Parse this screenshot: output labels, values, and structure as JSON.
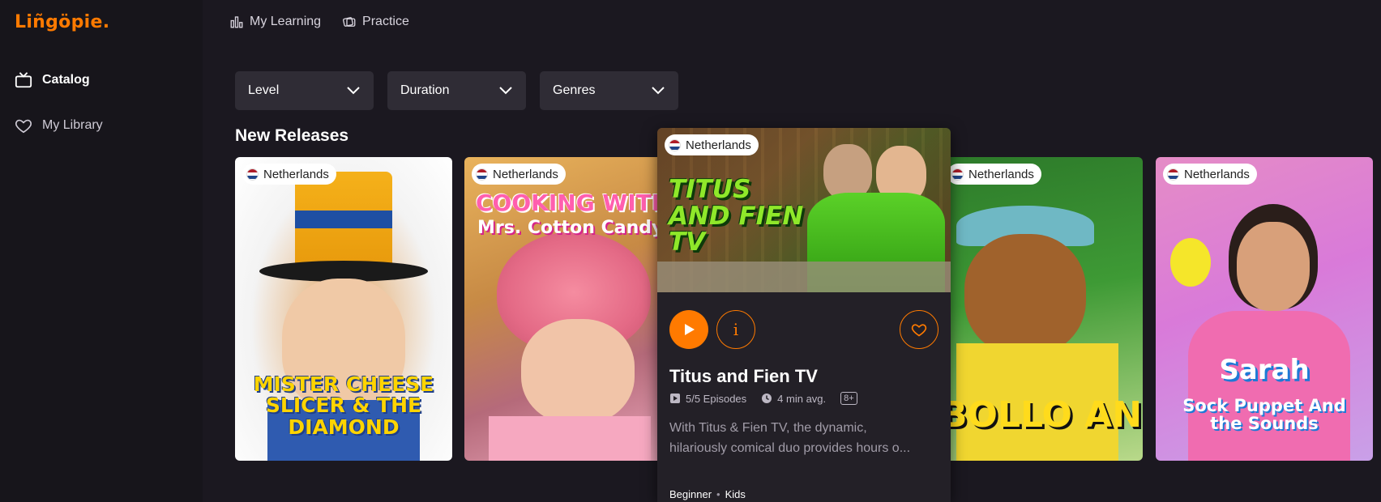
{
  "brand": {
    "logo": "Liñgöpie."
  },
  "sidebar": {
    "items": [
      {
        "label": "Catalog",
        "icon": "tv-icon",
        "active": true
      },
      {
        "label": "My Library",
        "icon": "heart-icon",
        "active": false
      }
    ]
  },
  "topnav": {
    "items": [
      {
        "label": "My Learning",
        "icon": "bar-chart-icon"
      },
      {
        "label": "Practice",
        "icon": "cards-icon"
      }
    ]
  },
  "filters": [
    {
      "label": "Level"
    },
    {
      "label": "Duration"
    },
    {
      "label": "Genres"
    }
  ],
  "section": {
    "title": "New Releases"
  },
  "cards": [
    {
      "country": "Netherlands",
      "art_title": "MISTER CHEESE SLICER & THE DIAMOND"
    },
    {
      "country": "Netherlands",
      "art_title_top": "COOKING WITH",
      "art_title_sub": "Mrs. Cotton Candy"
    },
    {
      "country": "Netherlands",
      "art_title": "BOLLO AND FRIENDS"
    },
    {
      "country": "Netherlands",
      "art_title_main": "Sarah",
      "art_title_sub": "Sock Puppet And the Sounds"
    }
  ],
  "expanded": {
    "country": "Netherlands",
    "art_title": "TITUS AND FIEN TV",
    "title": "Titus and Fien TV",
    "episodes": "5/5 Episodes",
    "duration": "4 min avg.",
    "age_rating": "8+",
    "description_line1": "With Titus & Fien TV, the dynamic,",
    "description_line2": "hilariously comical duo provides hours o...",
    "level": "Beginner",
    "genre": "Kids",
    "accent": "#ff7a00"
  }
}
